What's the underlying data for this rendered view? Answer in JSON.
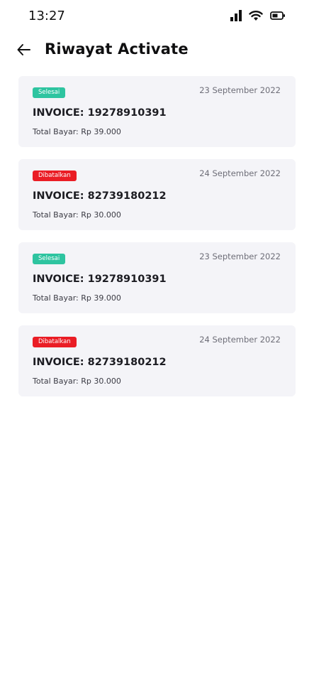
{
  "status_bar": {
    "time": "13:27",
    "icons": [
      "signal-icon",
      "wifi-icon",
      "battery-icon"
    ]
  },
  "header": {
    "back_icon": "arrow-left-icon",
    "title": "Riwayat Activate"
  },
  "colors": {
    "success": "#2ec4a0",
    "cancel": "#ea1d25",
    "card_bg": "#f4f4f8"
  },
  "transactions": [
    {
      "status": "Selesai",
      "status_type": "success",
      "date": "23 September 2022",
      "invoice": "INVOICE: 19278910391",
      "total": "Total Bayar: Rp 39.000"
    },
    {
      "status": "Dibatalkan",
      "status_type": "cancel",
      "date": "24 September 2022",
      "invoice": "INVOICE: 82739180212",
      "total": "Total Bayar: Rp 30.000"
    },
    {
      "status": "Selesai",
      "status_type": "success",
      "date": "23 September 2022",
      "invoice": "INVOICE: 19278910391",
      "total": "Total Bayar: Rp 39.000"
    },
    {
      "status": "Dibatalkan",
      "status_type": "cancel",
      "date": "24 September 2022",
      "invoice": "INVOICE: 82739180212",
      "total": "Total Bayar: Rp 30.000"
    }
  ]
}
